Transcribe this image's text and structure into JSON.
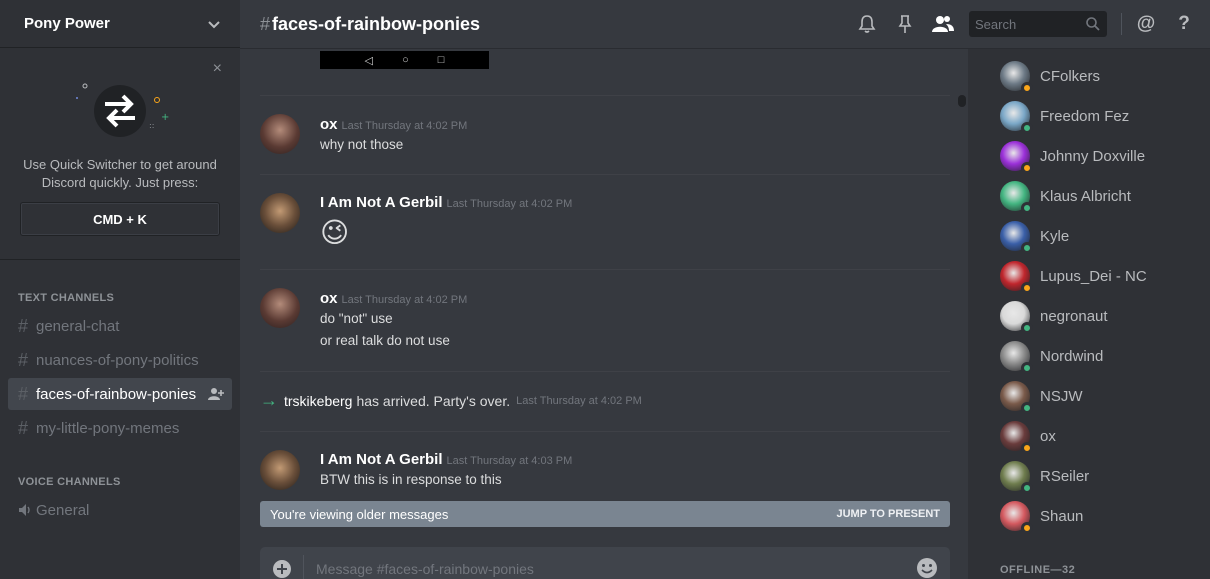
{
  "server": {
    "name": "Pony Power"
  },
  "quick_switcher": {
    "text": "Use Quick Switcher to get around Discord quickly. Just press:",
    "shortcut": "CMD + K",
    "close": "×"
  },
  "sidebar": {
    "text_header": "TEXT CHANNELS",
    "text_channels": [
      {
        "name": "general-chat"
      },
      {
        "name": "nuances-of-pony-politics"
      },
      {
        "name": "faces-of-rainbow-ponies"
      },
      {
        "name": "my-little-pony-memes"
      }
    ],
    "voice_header": "VOICE CHANNELS",
    "voice_channels": [
      {
        "name": "General"
      }
    ]
  },
  "header": {
    "hash": "#",
    "channel": "faces-of-rainbow-ponies",
    "search_placeholder": "Search",
    "at": "@",
    "help": "?"
  },
  "messages": [
    {
      "author": "ox",
      "timestamp": "Last Thursday at 4:02 PM",
      "lines": [
        "why not those"
      ]
    },
    {
      "author": "I Am Not A Gerbil",
      "timestamp": "Last Thursday at 4:02 PM",
      "emoji": "😉"
    },
    {
      "author": "ox",
      "timestamp": "Last Thursday at 4:02 PM",
      "lines": [
        "do \"not\" use",
        "or real talk do not use"
      ]
    },
    {
      "join_user": "trskikeberg",
      "join_text": "has arrived. Party's over.",
      "timestamp": "Last Thursday at 4:02 PM"
    },
    {
      "author": "I Am Not A Gerbil",
      "timestamp": "Last Thursday at 4:03 PM",
      "lines": [
        "BTW this is in response to this"
      ]
    }
  ],
  "older_bar": {
    "text": "You're viewing older messages",
    "jump": "JUMP TO PRESENT"
  },
  "composer": {
    "placeholder": "Message #faces-of-rainbow-ponies"
  },
  "members": [
    {
      "name": "CFolkers",
      "status": "idle",
      "color": "#6d7a86"
    },
    {
      "name": "Freedom Fez",
      "status": "online",
      "color": "#7aa7c7"
    },
    {
      "name": "Johnny Doxville",
      "status": "idle",
      "color": "#9b30d9"
    },
    {
      "name": "Klaus Albricht",
      "status": "online",
      "color": "#43b581"
    },
    {
      "name": "Kyle",
      "status": "online",
      "color": "#3a5fa8"
    },
    {
      "name": "Lupus_Dei - NC",
      "status": "idle",
      "color": "#c0262d"
    },
    {
      "name": "negronaut",
      "status": "online",
      "color": "#d9d9d9"
    },
    {
      "name": "Nordwind",
      "status": "online",
      "color": "#8a8a8a"
    },
    {
      "name": "NSJW",
      "status": "online",
      "color": "#7a5a4a"
    },
    {
      "name": "ox",
      "status": "idle",
      "color": "#6a3c3c"
    },
    {
      "name": "RSeiler",
      "status": "online",
      "color": "#6f7d4e"
    },
    {
      "name": "Shaun",
      "status": "idle",
      "color": "#d4595f"
    }
  ],
  "offline_header": "OFFLINE—32",
  "colors": {
    "online": "#43b581",
    "idle": "#faa61a",
    "accent": "#7289da"
  }
}
